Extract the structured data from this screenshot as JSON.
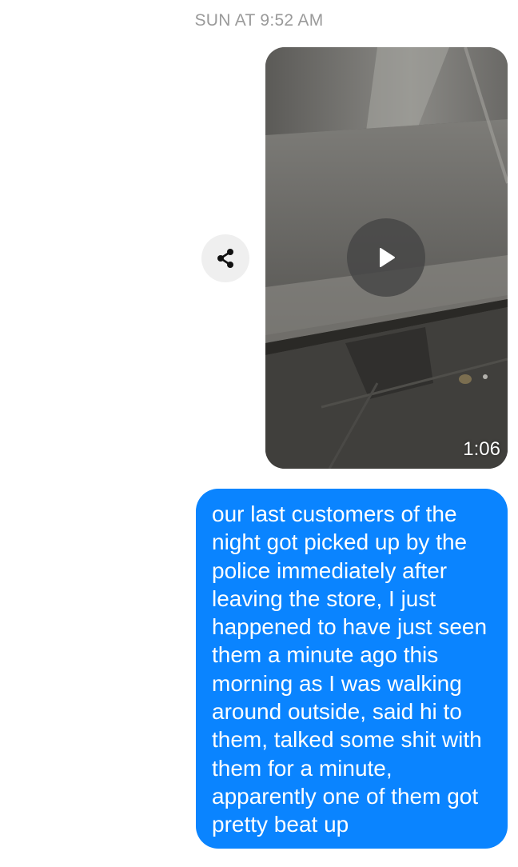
{
  "conversation": {
    "timestamp": "SUN AT 9:52 AM",
    "video_message": {
      "duration": "1:06",
      "play_icon": "play-icon",
      "share_icon": "share-icon"
    },
    "text_message": {
      "text": "our last customers of the night got picked up by the police immediately after leaving the store, I just happened to have just seen them a minute ago this morning as I was walking around outside, said hi to them, talked some shit with them for a minute, apparently one of them got pretty beat up"
    }
  },
  "colors": {
    "sent_bubble": "#0a84ff",
    "timestamp_text": "#9a9a9a",
    "share_button_bg": "#efefef"
  }
}
